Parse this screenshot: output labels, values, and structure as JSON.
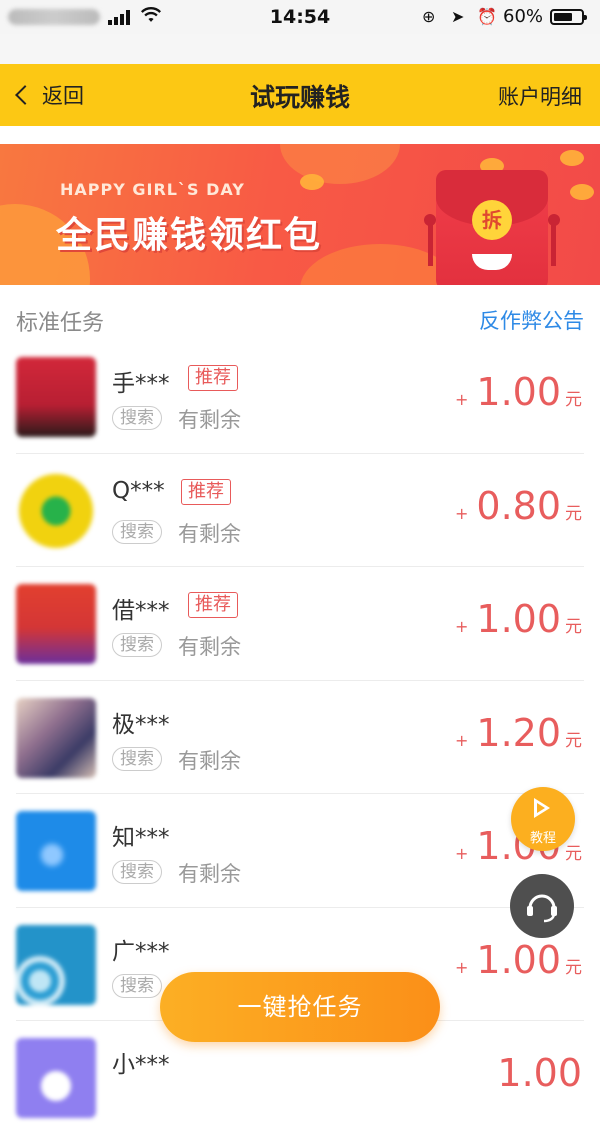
{
  "status_bar": {
    "time": "14:54",
    "battery": "60%"
  },
  "nav": {
    "back_label": "返回",
    "title": "试玩赚钱",
    "right_label": "账户明细"
  },
  "banner": {
    "subtitle": "HAPPY GIRL`S DAY",
    "title": "全民赚钱领红包",
    "envelope_text": "拆"
  },
  "section": {
    "title": "标准任务",
    "link": "反作弊公告"
  },
  "tasks": [
    {
      "name": "手***",
      "tag": "推荐",
      "search_tag": "搜索",
      "status": "有剩余",
      "plus": "+",
      "amount": "1.00",
      "unit": "元"
    },
    {
      "name": "Q***",
      "tag": "推荐",
      "search_tag": "搜索",
      "status": "有剩余",
      "plus": "+",
      "amount": "0.80",
      "unit": "元"
    },
    {
      "name": "借***",
      "tag": "推荐",
      "search_tag": "搜索",
      "status": "有剩余",
      "plus": "+",
      "amount": "1.00",
      "unit": "元"
    },
    {
      "name": "极***",
      "tag": "",
      "search_tag": "搜索",
      "status": "有剩余",
      "plus": "+",
      "amount": "1.20",
      "unit": "元"
    },
    {
      "name": "知***",
      "tag": "",
      "search_tag": "搜索",
      "status": "有剩余",
      "plus": "+",
      "amount": "1.00",
      "unit": "元"
    },
    {
      "name": "广***",
      "tag": "",
      "search_tag": "搜索",
      "status": "",
      "plus": "+",
      "amount": "1.00",
      "unit": "元"
    },
    {
      "name": "小***",
      "tag": "",
      "search_tag": "",
      "status": "",
      "plus": "",
      "amount": "1.00",
      "unit": ""
    }
  ],
  "floating": {
    "tutorial_label": "教程",
    "grab_button": "一键抢任务"
  },
  "colors": {
    "nav_bg": "#fcc814",
    "reward": "#e85d5d",
    "link": "#2e8ae6",
    "grab_button": "#fb9a1c"
  }
}
